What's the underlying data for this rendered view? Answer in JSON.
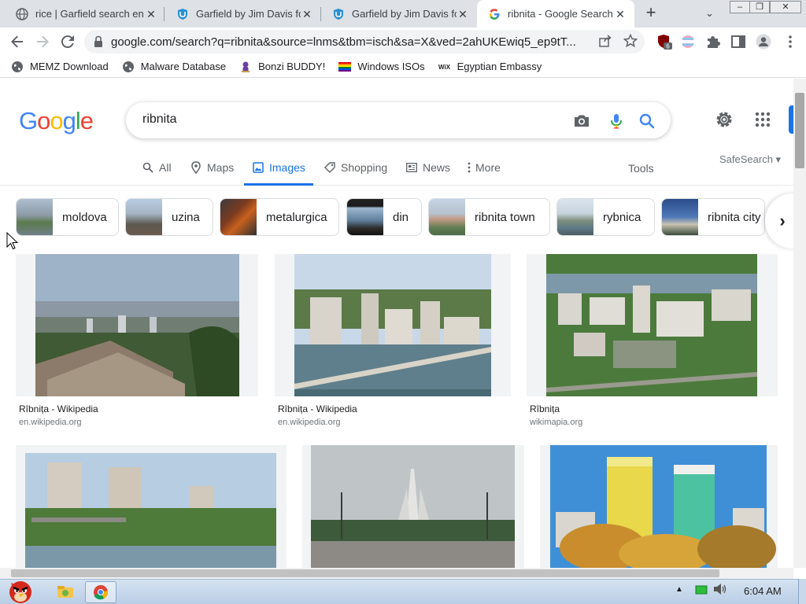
{
  "browser": {
    "tabs": [
      {
        "title": "rice | Garfield search en",
        "favicon": "globe-icon"
      },
      {
        "title": "Garfield by Jim Davis fo",
        "favicon": "shield-icon"
      },
      {
        "title": "Garfield by Jim Davis fo",
        "favicon": "shield-icon"
      },
      {
        "title": "ribnita - Google Search",
        "favicon": "google-g-icon"
      }
    ],
    "new_tab_label": "+",
    "url": "google.com/search?q=ribnita&source=lnms&tbm=isch&sa=X&ved=2ahUKEwiq5_ep9tT...",
    "extension_badge": "6",
    "bookmarks": [
      {
        "label": "MEMZ Download",
        "icon": "globe-icon"
      },
      {
        "label": "Malware Database",
        "icon": "globe-icon"
      },
      {
        "label": "Bonzi BUDDY!",
        "icon": "bonzi-icon"
      },
      {
        "label": "Windows ISOs",
        "icon": "rainbow-flag-icon"
      },
      {
        "label": "Egyptian Embassy",
        "icon": "wix-icon"
      }
    ]
  },
  "google": {
    "logo": "Google",
    "query": "ribnita",
    "tabs": [
      {
        "label": "All",
        "icon": "search-icon"
      },
      {
        "label": "Maps",
        "icon": "map-pin-icon"
      },
      {
        "label": "Images",
        "icon": "image-icon"
      },
      {
        "label": "Shopping",
        "icon": "tag-icon"
      },
      {
        "label": "News",
        "icon": "news-icon"
      },
      {
        "label": "More",
        "icon": "more-vert-icon"
      }
    ],
    "tools_label": "Tools",
    "safesearch_label": "SafeSearch ▾",
    "chips": [
      "moldova",
      "uzina",
      "metalurgica",
      "din",
      "ribnita town",
      "rybnica",
      "ribnita city"
    ],
    "results": [
      {
        "caption": "Rîbnița - Wikipedia",
        "source": "en.wikipedia.org"
      },
      {
        "caption": "Rîbnița - Wikipedia",
        "source": "en.wikipedia.org"
      },
      {
        "caption": "Rîbnița",
        "source": "wikimapia.org"
      },
      {
        "caption": "",
        "source": ""
      },
      {
        "caption": "",
        "source": ""
      },
      {
        "caption": "",
        "source": ""
      }
    ]
  },
  "taskbar": {
    "clock": "6:04 AM"
  },
  "colors": {
    "accent": "#1a73e8",
    "tabstrip": "#dee1e6"
  }
}
